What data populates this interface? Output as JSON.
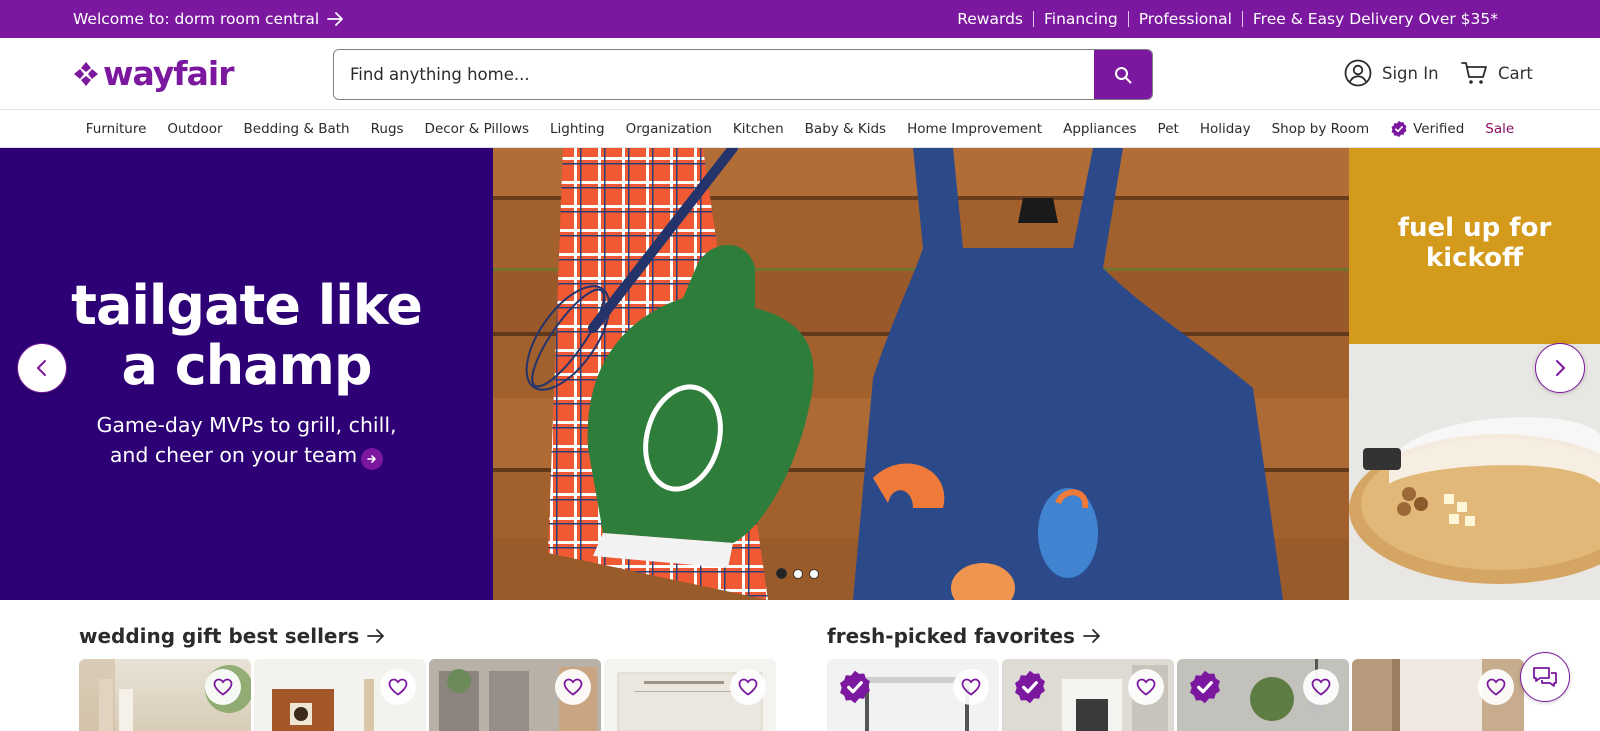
{
  "promo_bar": {
    "welcome": "Welcome to: dorm room central",
    "links": [
      "Rewards",
      "Financing",
      "Professional",
      "Free & Easy Delivery Over $35*"
    ]
  },
  "header": {
    "logo_text": "wayfair",
    "search_placeholder": "Find anything home...",
    "sign_in": "Sign In",
    "cart": "Cart"
  },
  "nav": {
    "categories": [
      "Furniture",
      "Outdoor",
      "Bedding & Bath",
      "Rugs",
      "Decor & Pillows",
      "Lighting",
      "Organization",
      "Kitchen",
      "Baby & Kids",
      "Home Improvement",
      "Appliances",
      "Pet",
      "Holiday",
      "Shop by Room"
    ],
    "verified": "Verified",
    "sale": "Sale"
  },
  "hero": {
    "headline_line1": "tailgate like",
    "headline_line2": "a champ",
    "sub_line1": "Game-day MVPs to grill, chill,",
    "sub_line2": "and cheer on your team",
    "next_slide_text": "fuel up for kickoff",
    "slide_count": 3,
    "active_slide": 1
  },
  "sections": [
    {
      "title": "wedding gift best sellers",
      "card_count": 4
    },
    {
      "title": "fresh-picked favorites",
      "card_count": 4
    }
  ],
  "colors": {
    "brand_purple": "#7b189f",
    "hero_navy": "#2d0075",
    "gold": "#d39a1c",
    "sale_text": "#8a0d63"
  },
  "icons": {
    "search": "search-icon",
    "account": "user-circle-icon",
    "cart": "cart-icon",
    "verified": "verified-badge-icon",
    "favorite": "heart-icon",
    "chat": "chat-icon"
  }
}
